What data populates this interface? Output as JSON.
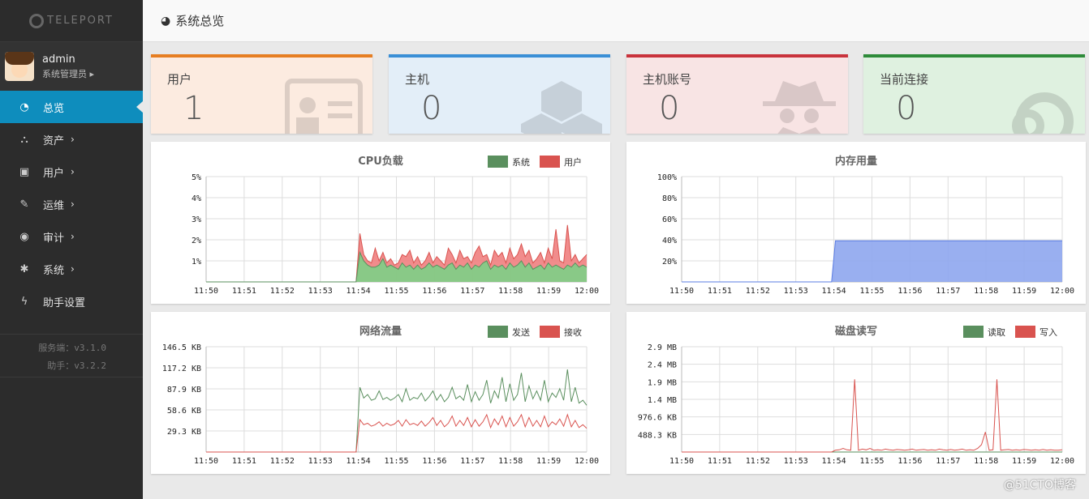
{
  "app": {
    "logo": "TELEPORT"
  },
  "user": {
    "name": "admin",
    "role": "系统管理员"
  },
  "nav": [
    {
      "label": "总览",
      "icon": "dashboard-icon",
      "sub": false
    },
    {
      "label": "资产",
      "icon": "assets-icon",
      "sub": true
    },
    {
      "label": "用户",
      "icon": "user-card-icon",
      "sub": true
    },
    {
      "label": "运维",
      "icon": "wrench-icon",
      "sub": true
    },
    {
      "label": "审计",
      "icon": "eye-icon",
      "sub": true
    },
    {
      "label": "系统",
      "icon": "gear-icon",
      "sub": true
    },
    {
      "label": "助手设置",
      "icon": "bolt-icon",
      "sub": false
    }
  ],
  "versions": {
    "server": "服务端：v3.1.0",
    "assist": "助手：v3.2.2"
  },
  "header": {
    "title": "系统总览"
  },
  "cards": [
    {
      "title": "用户",
      "value": "1",
      "color": "#e67e22",
      "bg": "#fcebe0"
    },
    {
      "title": "主机",
      "value": "0",
      "color": "#3a8fd6",
      "bg": "#e3eef8"
    },
    {
      "title": "主机账号",
      "value": "0",
      "color": "#c9333c",
      "bg": "#f8e4e4"
    },
    {
      "title": "当前连接",
      "value": "0",
      "color": "#2e8b3a",
      "bg": "#dff1e0"
    }
  ],
  "chart_data": [
    {
      "type": "area",
      "title": "CPU负载",
      "x": [
        "11:50",
        "11:51",
        "11:52",
        "11:53",
        "11:54",
        "11:55",
        "11:56",
        "11:57",
        "11:58",
        "11:59",
        "12:00"
      ],
      "yticks": [
        "1%",
        "2%",
        "3%",
        "4%",
        "5%"
      ],
      "ylim": [
        0,
        5
      ],
      "legend": "top-right",
      "series": [
        {
          "name": "系统",
          "color": "#5a8f5e",
          "fill": "#7dcf86",
          "values": [
            0,
            0,
            0,
            0,
            0,
            0,
            0,
            0,
            0,
            0,
            0,
            0,
            0,
            0,
            0,
            0,
            0,
            0,
            0,
            0,
            0,
            0,
            0,
            0,
            0,
            0,
            0,
            0,
            0,
            0,
            0,
            0,
            0,
            0,
            0,
            0,
            0,
            0,
            0,
            0,
            1.4,
            1.0,
            0.8,
            0.7,
            0.7,
            0.8,
            1.1,
            0.7,
            0.8,
            0.7,
            0.6,
            0.9,
            0.7,
            0.8,
            0.6,
            0.8,
            0.6,
            0.7,
            0.9,
            0.7,
            0.8,
            0.7,
            0.6,
            0.8,
            0.9,
            0.6,
            0.8,
            0.7,
            0.9,
            0.6,
            0.8,
            0.7,
            0.9,
            1.0,
            0.6,
            0.8,
            0.7,
            0.8,
            0.6,
            0.9,
            0.7,
            0.8,
            1.0,
            0.7,
            0.9,
            0.6,
            0.7,
            0.8,
            0.6,
            0.9,
            0.7,
            0.8,
            0.7,
            0.6,
            0.8,
            0.7,
            0.9,
            0.7,
            0.8,
            0.7
          ]
        },
        {
          "name": "用户",
          "color": "#d9534f",
          "fill": "#f08080",
          "values": [
            0,
            0,
            0,
            0,
            0,
            0,
            0,
            0,
            0,
            0,
            0,
            0,
            0,
            0,
            0,
            0,
            0,
            0,
            0,
            0,
            0,
            0,
            0,
            0,
            0,
            0,
            0,
            0,
            0,
            0,
            0,
            0,
            0,
            0,
            0,
            0,
            0,
            0,
            0,
            0,
            2.3,
            1.3,
            1.0,
            0.9,
            1.6,
            1.0,
            1.4,
            0.9,
            1.1,
            0.8,
            0.9,
            1.3,
            1.2,
            1.5,
            0.9,
            1.2,
            0.8,
            1.0,
            1.4,
            0.9,
            1.2,
            1.0,
            0.8,
            1.6,
            1.3,
            0.9,
            1.5,
            1.1,
            1.2,
            0.9,
            1.4,
            1.7,
            1.2,
            1.3,
            0.8,
            1.5,
            1.2,
            1.4,
            0.9,
            1.6,
            1.1,
            1.3,
            1.8,
            1.2,
            1.5,
            0.9,
            1.1,
            1.4,
            0.9,
            1.6,
            1.1,
            2.5,
            1.0,
            0.9,
            2.7,
            1.0,
            1.3,
            0.9,
            1.1,
            1.3
          ]
        }
      ]
    },
    {
      "type": "area",
      "title": "内存用量",
      "x": [
        "11:50",
        "11:51",
        "11:52",
        "11:53",
        "11:54",
        "11:55",
        "11:56",
        "11:57",
        "11:58",
        "11:59",
        "12:00"
      ],
      "yticks": [
        "20%",
        "40%",
        "60%",
        "80%",
        "100%"
      ],
      "ylim": [
        0,
        100
      ],
      "series": [
        {
          "name": "",
          "color": "#5b7de3",
          "fill": "#8ea6ee",
          "values": [
            0,
            0,
            0,
            0,
            0,
            0,
            0,
            0,
            0,
            0,
            0,
            0,
            0,
            0,
            0,
            0,
            0,
            0,
            0,
            0,
            0,
            0,
            0,
            0,
            0,
            0,
            0,
            0,
            0,
            0,
            0,
            0,
            0,
            0,
            0,
            0,
            0,
            0,
            0,
            0,
            39,
            39,
            39,
            39,
            39,
            39,
            39,
            39,
            39,
            39,
            39,
            39,
            39,
            39,
            39,
            39,
            39,
            39,
            39,
            39,
            39,
            39,
            39,
            39,
            39,
            39,
            39,
            39,
            39,
            39,
            39,
            39,
            39,
            39,
            39,
            39,
            39,
            39,
            39,
            39,
            39,
            39,
            39,
            39,
            39,
            39,
            39,
            39,
            39,
            39,
            39,
            39,
            39,
            39,
            39,
            39,
            39,
            39,
            39,
            39
          ]
        }
      ]
    },
    {
      "type": "line",
      "title": "网络流量",
      "x": [
        "11:50",
        "11:51",
        "11:52",
        "11:53",
        "11:54",
        "11:55",
        "11:56",
        "11:57",
        "11:58",
        "11:59",
        "12:00"
      ],
      "yticks": [
        "29.3 KB",
        "58.6 KB",
        "87.9 KB",
        "117.2 KB",
        "146.5 KB"
      ],
      "ylim": [
        0,
        146.5
      ],
      "legend": "top-right",
      "series": [
        {
          "name": "发送",
          "color": "#5a8f5e",
          "values": [
            0,
            0,
            0,
            0,
            0,
            0,
            0,
            0,
            0,
            0,
            0,
            0,
            0,
            0,
            0,
            0,
            0,
            0,
            0,
            0,
            0,
            0,
            0,
            0,
            0,
            0,
            0,
            0,
            0,
            0,
            0,
            0,
            0,
            0,
            0,
            0,
            0,
            0,
            0,
            0,
            90,
            75,
            80,
            72,
            74,
            85,
            73,
            76,
            72,
            75,
            80,
            70,
            88,
            72,
            76,
            74,
            82,
            71,
            77,
            85,
            72,
            80,
            70,
            76,
            90,
            74,
            78,
            72,
            94,
            70,
            84,
            72,
            80,
            100,
            68,
            85,
            75,
            104,
            70,
            95,
            72,
            80,
            110,
            70,
            92,
            74,
            85,
            72,
            100,
            70,
            82,
            76,
            88,
            72,
            115,
            70,
            90,
            68,
            72,
            65
          ]
        },
        {
          "name": "接收",
          "color": "#d9534f",
          "values": [
            0,
            0,
            0,
            0,
            0,
            0,
            0,
            0,
            0,
            0,
            0,
            0,
            0,
            0,
            0,
            0,
            0,
            0,
            0,
            0,
            0,
            0,
            0,
            0,
            0,
            0,
            0,
            0,
            0,
            0,
            0,
            0,
            0,
            0,
            0,
            0,
            0,
            0,
            0,
            0,
            45,
            38,
            40,
            36,
            38,
            42,
            36,
            40,
            37,
            39,
            44,
            36,
            45,
            38,
            40,
            37,
            43,
            36,
            41,
            48,
            37,
            44,
            35,
            40,
            50,
            36,
            44,
            37,
            48,
            35,
            45,
            36,
            42,
            52,
            34,
            46,
            38,
            50,
            35,
            48,
            36,
            42,
            52,
            35,
            48,
            36,
            44,
            35,
            50,
            35,
            42,
            38,
            46,
            36,
            52,
            35,
            44,
            34,
            38,
            33
          ]
        }
      ]
    },
    {
      "type": "line",
      "title": "磁盘读写",
      "x": [
        "11:50",
        "11:51",
        "11:52",
        "11:53",
        "11:54",
        "11:55",
        "11:56",
        "11:57",
        "11:58",
        "11:59",
        "12:00"
      ],
      "yticks": [
        "488.3 KB",
        "976.6 KB",
        "1.4 MB",
        "1.9 MB",
        "2.4 MB",
        "2.9 MB"
      ],
      "ylim": [
        0,
        2.9
      ],
      "legend": "top-right",
      "series": [
        {
          "name": "读取",
          "color": "#5a8f5e",
          "values": [
            0,
            0,
            0,
            0,
            0,
            0,
            0,
            0,
            0,
            0,
            0,
            0,
            0,
            0,
            0,
            0,
            0,
            0,
            0,
            0,
            0,
            0,
            0,
            0,
            0,
            0,
            0,
            0,
            0,
            0,
            0,
            0,
            0,
            0,
            0,
            0,
            0,
            0,
            0,
            0,
            0,
            0,
            0,
            0,
            0,
            0,
            0,
            0,
            0,
            0,
            0,
            0,
            0,
            0,
            0,
            0,
            0,
            0,
            0,
            0,
            0,
            0,
            0,
            0,
            0,
            0,
            0,
            0,
            0,
            0,
            0,
            0,
            0,
            0,
            0,
            0,
            0,
            0,
            0,
            0,
            0,
            0,
            0,
            0,
            0,
            0,
            0,
            0,
            0,
            0,
            0,
            0,
            0,
            0,
            0,
            0,
            0,
            0,
            0,
            0
          ]
        },
        {
          "name": "写入",
          "color": "#d9534f",
          "values": [
            0,
            0,
            0,
            0,
            0,
            0,
            0,
            0,
            0,
            0,
            0,
            0,
            0,
            0,
            0,
            0,
            0,
            0,
            0,
            0,
            0,
            0,
            0,
            0,
            0,
            0,
            0,
            0,
            0,
            0,
            0,
            0,
            0,
            0,
            0,
            0,
            0,
            0,
            0,
            0,
            0.05,
            0.06,
            0.1,
            0.06,
            0.05,
            2.0,
            0.05,
            0.08,
            0.06,
            0.1,
            0.05,
            0.06,
            0.05,
            0.08,
            0.06,
            0.05,
            0.07,
            0.06,
            0.05,
            0.06,
            0.08,
            0.05,
            0.06,
            0.07,
            0.05,
            0.06,
            0.05,
            0.08,
            0.06,
            0.05,
            0.07,
            0.05,
            0.06,
            0.08,
            0.05,
            0.06,
            0.05,
            0.1,
            0.2,
            0.55,
            0.05,
            0.06,
            2.0,
            0.05,
            0.06,
            0.07,
            0.05,
            0.06,
            0.05,
            0.07,
            0.06,
            0.05,
            0.06,
            0.05,
            0.07,
            0.05,
            0.06,
            0.05,
            0.05,
            0.06
          ]
        }
      ]
    }
  ]
}
